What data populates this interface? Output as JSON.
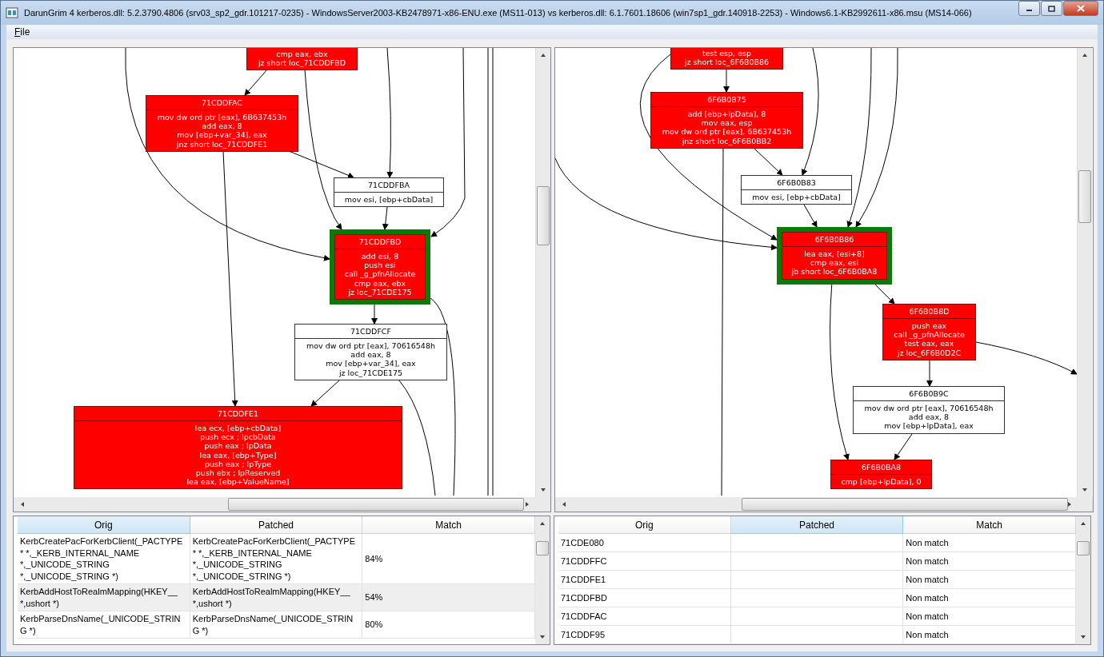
{
  "window": {
    "title": "DarunGrim 4 kerberos.dll: 5.2.3790.4806 (srv03_sp2_gdr.101217-0235) - WindowsServer2003-KB2478971-x86-ENU.exe (MS11-013) vs kerberos.dll: 6.1.7601.18606 (win7sp1_gdr.140918-2253) - Windows6.1-KB2992611-x86.msu (MS14-066)"
  },
  "menu": [
    {
      "label": "File"
    }
  ],
  "graphs": [
    {
      "nodes": [
        {
          "kind": "modified",
          "selected": false,
          "lines": [
            "cmp eax, ebx",
            "jz short loc_71CDDFBD"
          ]
        },
        {
          "kind": "modified",
          "selected": false,
          "title": "71CDDFAC",
          "lines": [
            "mov dw ord ptr [eax], 6B637453h",
            "add eax, 8",
            "mov [ebp+var_34], eax",
            "jnz short loc_71CDDFE1"
          ]
        },
        {
          "kind": "matched",
          "selected": false,
          "title": "71CDDFBA",
          "lines": [
            "mov esi, [ebp+cbData]"
          ]
        },
        {
          "kind": "modified",
          "selected": true,
          "title": "71CDDFBD",
          "lines": [
            "add esi, 8",
            "push esi",
            "call _g_pfnAllocate",
            "cmp eax, ebx",
            "jz loc_71CDE175"
          ]
        },
        {
          "kind": "matched",
          "selected": false,
          "title": "71CDDFCF",
          "lines": [
            "mov dw ord ptr [eax], 70616548h",
            "add eax, 8",
            "mov [ebp+var_34], eax",
            "jz loc_71CDE175"
          ]
        },
        {
          "kind": "modified",
          "selected": false,
          "title": "71CDDFE1",
          "lines": [
            "lea ecx, [ebp+cbData]",
            "push ecx ; lpcbData",
            "push eax ; lpData",
            "lea eax, [ebp+Type]",
            "push eax ; lpType",
            "push ebx ; lpReserved",
            "lea eax, [ebp+ValueName]"
          ]
        }
      ]
    },
    {
      "nodes": [
        {
          "kind": "modified",
          "selected": false,
          "lines": [
            "test esp, esp",
            "jz short loc_6F6B0B86"
          ]
        },
        {
          "kind": "modified",
          "selected": false,
          "title": "6F6B0B75",
          "lines": [
            "add [ebp+lpData], 8",
            "mov eax, esp",
            "mov dw ord ptr [eax], 6B637453h",
            "jnz short loc_6F6B0BB2"
          ]
        },
        {
          "kind": "matched",
          "selected": false,
          "title": "6F6B0B83",
          "lines": [
            "mov esi, [ebp+cbData]"
          ]
        },
        {
          "kind": "modified",
          "selected": true,
          "title": "6F6B0B86",
          "lines": [
            "lea eax, [esi+8]",
            "cmp eax, esi",
            "jb short loc_6F6B0BA8"
          ]
        },
        {
          "kind": "modified",
          "selected": false,
          "title": "6F6B0B8D",
          "lines": [
            "push eax",
            "call _g_pfnAllocate",
            "test eax, eax",
            "jz loc_6F6B0D2C"
          ]
        },
        {
          "kind": "matched",
          "selected": false,
          "title": "6F6B0B9C",
          "lines": [
            "mov dw ord ptr [eax], 70616548h",
            "add eax, 8",
            "mov [ebp+lpData], eax"
          ]
        },
        {
          "kind": "modified",
          "selected": false,
          "title": "6F6B0BA8",
          "lines": [
            "cmp [ebp+lpData], 0"
          ]
        }
      ]
    }
  ],
  "tables": [
    {
      "columns": [
        {
          "label": "Orig",
          "sorted": true
        },
        {
          "label": "Patched",
          "sorted": false
        },
        {
          "label": "Match",
          "sorted": false
        }
      ],
      "rows": [
        {
          "selected": false,
          "cells": [
            "KerbCreatePacForKerbClient(_PACTYPE * *,_KERB_INTERNAL_NAME *,_UNICODE_STRING *,_UNICODE_STRING *)",
            "KerbCreatePacForKerbClient(_PACTYPE * *,_KERB_INTERNAL_NAME *,_UNICODE_STRING *,_UNICODE_STRING *)",
            "84%"
          ]
        },
        {
          "selected": true,
          "cells": [
            "KerbAddHostToRealmMapping(HKEY__ *,ushort *)",
            "KerbAddHostToRealmMapping(HKEY__ *,ushort *)",
            "54%"
          ]
        },
        {
          "selected": false,
          "cells": [
            "KerbParseDnsName(_UNICODE_STRING *)",
            "KerbParseDnsName(_UNICODE_STRING *)",
            "80%"
          ]
        }
      ]
    },
    {
      "columns": [
        {
          "label": "Orig",
          "sorted": false
        },
        {
          "label": "Patched",
          "sorted": true
        },
        {
          "label": "Match",
          "sorted": false
        }
      ],
      "rows": [
        {
          "selected": false,
          "cells": [
            "71CDE080",
            "",
            "Non match"
          ]
        },
        {
          "selected": false,
          "cells": [
            "71CDDFFC",
            "",
            "Non match"
          ]
        },
        {
          "selected": false,
          "cells": [
            "71CDDFE1",
            "",
            "Non match"
          ]
        },
        {
          "selected": false,
          "cells": [
            "71CDDFBD",
            "",
            "Non match"
          ]
        },
        {
          "selected": false,
          "cells": [
            "71CDDFAC",
            "",
            "Non match"
          ]
        },
        {
          "selected": false,
          "cells": [
            "71CDDF95",
            "",
            "Non match"
          ]
        }
      ]
    }
  ]
}
